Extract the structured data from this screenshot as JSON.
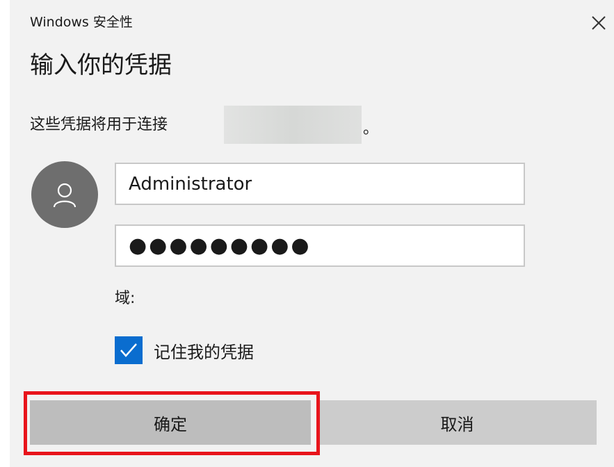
{
  "window": {
    "title": "Windows 安全性",
    "close_icon": "close-icon"
  },
  "heading": "输入你的凭据",
  "description": {
    "text": "这些凭据将用于连接",
    "redacted_target": "",
    "period": "。"
  },
  "avatar": {
    "icon": "user-icon"
  },
  "username_field": {
    "value": "Administrator"
  },
  "password_field": {
    "value": "●●●●●●●●●"
  },
  "domain": {
    "label": "域:"
  },
  "remember": {
    "label": "记住我的凭据",
    "checked": true
  },
  "buttons": {
    "ok_label": "确定",
    "cancel_label": "取消"
  },
  "highlight": {
    "color": "#e8141b",
    "target": "ok-button"
  },
  "colors": {
    "accent": "#0a6dcf",
    "background": "#f2f2f2",
    "avatar": "#6e6e6e"
  }
}
